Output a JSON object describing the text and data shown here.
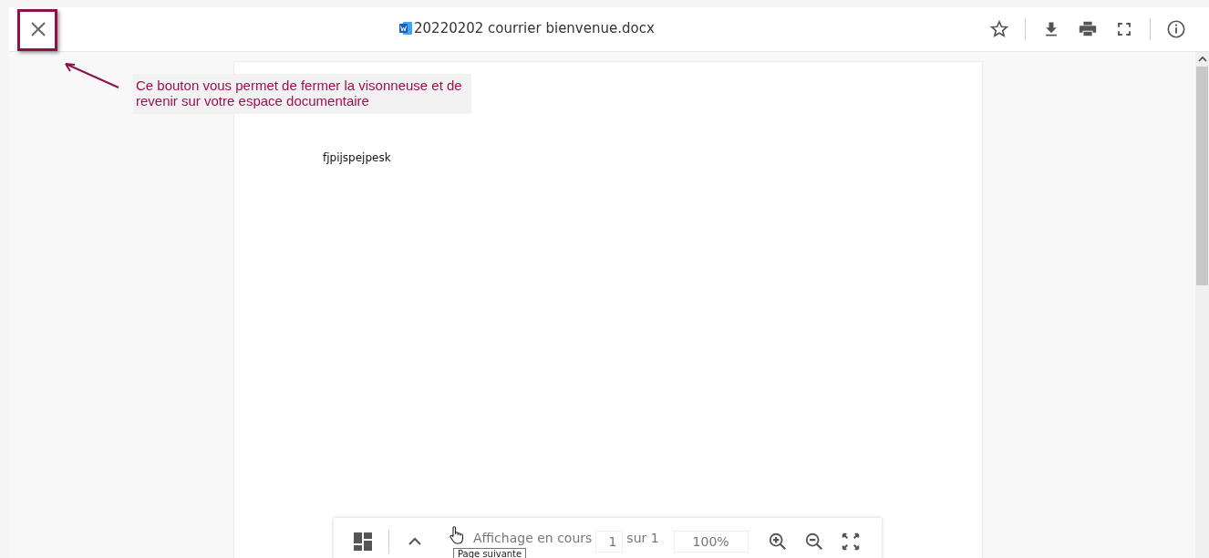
{
  "header": {
    "title": "20220202 courrier bienvenue.docx"
  },
  "annotation": {
    "text": "Ce bouton vous permet de fermer la visonneuse et de revenir sur votre espace documentaire"
  },
  "document": {
    "text": "fjpijspejpesk"
  },
  "toolbar": {
    "label": "Affichage en cours",
    "page": "1",
    "total": "sur 1",
    "zoom": "100%"
  },
  "tooltip": {
    "text": "Page suivante"
  }
}
